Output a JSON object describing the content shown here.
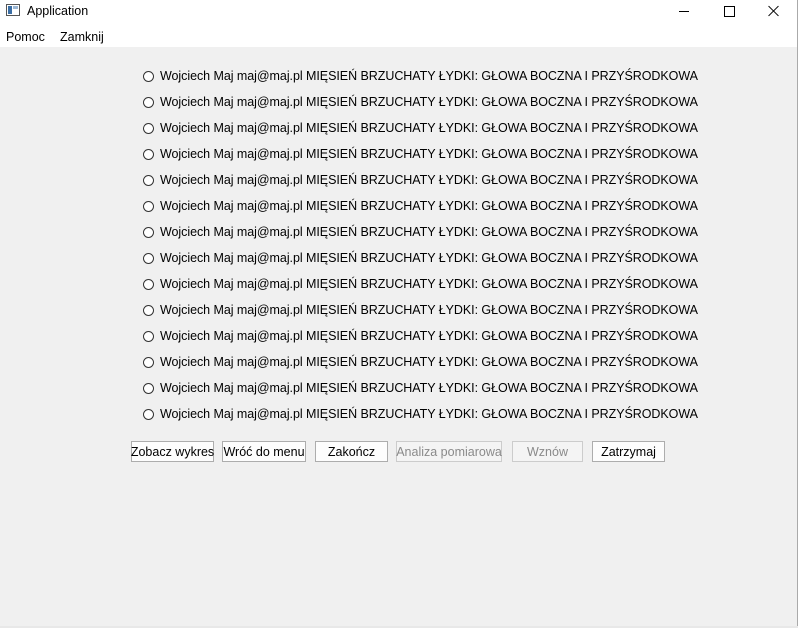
{
  "window": {
    "title": "Application",
    "controls": {
      "minimize": "minimize-icon",
      "maximize": "maximize-icon",
      "close": "close-icon"
    }
  },
  "menubar": {
    "items": [
      {
        "label": "Pomoc"
      },
      {
        "label": "Zamknij"
      }
    ]
  },
  "radio_items": [
    {
      "label": "Wojciech Maj maj@maj.pl  MIĘSIEŃ BRZUCHATY ŁYDKI: GŁOWA BOCZNA I PRZYŚRODKOWA",
      "checked": false
    },
    {
      "label": "Wojciech Maj maj@maj.pl  MIĘSIEŃ BRZUCHATY ŁYDKI: GŁOWA BOCZNA I PRZYŚRODKOWA",
      "checked": false
    },
    {
      "label": "Wojciech Maj maj@maj.pl  MIĘSIEŃ BRZUCHATY ŁYDKI: GŁOWA BOCZNA I PRZYŚRODKOWA",
      "checked": false
    },
    {
      "label": "Wojciech Maj maj@maj.pl  MIĘSIEŃ BRZUCHATY ŁYDKI: GŁOWA BOCZNA I PRZYŚRODKOWA",
      "checked": false
    },
    {
      "label": "Wojciech Maj maj@maj.pl  MIĘSIEŃ BRZUCHATY ŁYDKI: GŁOWA BOCZNA I PRZYŚRODKOWA",
      "checked": false
    },
    {
      "label": "Wojciech Maj maj@maj.pl  MIĘSIEŃ BRZUCHATY ŁYDKI: GŁOWA BOCZNA I PRZYŚRODKOWA",
      "checked": false
    },
    {
      "label": "Wojciech Maj maj@maj.pl  MIĘSIEŃ BRZUCHATY ŁYDKI: GŁOWA BOCZNA I PRZYŚRODKOWA",
      "checked": false
    },
    {
      "label": "Wojciech Maj maj@maj.pl  MIĘSIEŃ BRZUCHATY ŁYDKI: GŁOWA BOCZNA I PRZYŚRODKOWA",
      "checked": false
    },
    {
      "label": "Wojciech Maj maj@maj.pl  MIĘSIEŃ BRZUCHATY ŁYDKI: GŁOWA BOCZNA I PRZYŚRODKOWA",
      "checked": false
    },
    {
      "label": "Wojciech Maj maj@maj.pl  MIĘSIEŃ BRZUCHATY ŁYDKI: GŁOWA BOCZNA I PRZYŚRODKOWA",
      "checked": false
    },
    {
      "label": "Wojciech Maj maj@maj.pl  MIĘSIEŃ BRZUCHATY ŁYDKI: GŁOWA BOCZNA I PRZYŚRODKOWA",
      "checked": false
    },
    {
      "label": "Wojciech Maj maj@maj.pl  MIĘSIEŃ BRZUCHATY ŁYDKI: GŁOWA BOCZNA I PRZYŚRODKOWA",
      "checked": false
    },
    {
      "label": "Wojciech Maj maj@maj.pl  MIĘSIEŃ BRZUCHATY ŁYDKI: GŁOWA BOCZNA I PRZYŚRODKOWA",
      "checked": false
    },
    {
      "label": "Wojciech Maj maj@maj.pl  MIĘSIEŃ BRZUCHATY ŁYDKI: GŁOWA BOCZNA I PRZYŚRODKOWA",
      "checked": false
    }
  ],
  "buttons": {
    "show_chart": {
      "label": "Zobacz wykres",
      "enabled": true
    },
    "back_to_menu": {
      "label": "Wróć do menu",
      "enabled": true
    },
    "finish": {
      "label": "Zakończ",
      "enabled": true
    },
    "measurement_analysis": {
      "label": "Analiza pomiarowa",
      "enabled": false
    },
    "resume": {
      "label": "Wznów",
      "enabled": false
    },
    "stop": {
      "label": "Zatrzymaj",
      "enabled": true
    }
  },
  "colors": {
    "window_background": "#f0f0f0",
    "titlebar_background": "#ffffff",
    "disabled_text": "#8a8a8a",
    "button_border": "#adadad"
  }
}
